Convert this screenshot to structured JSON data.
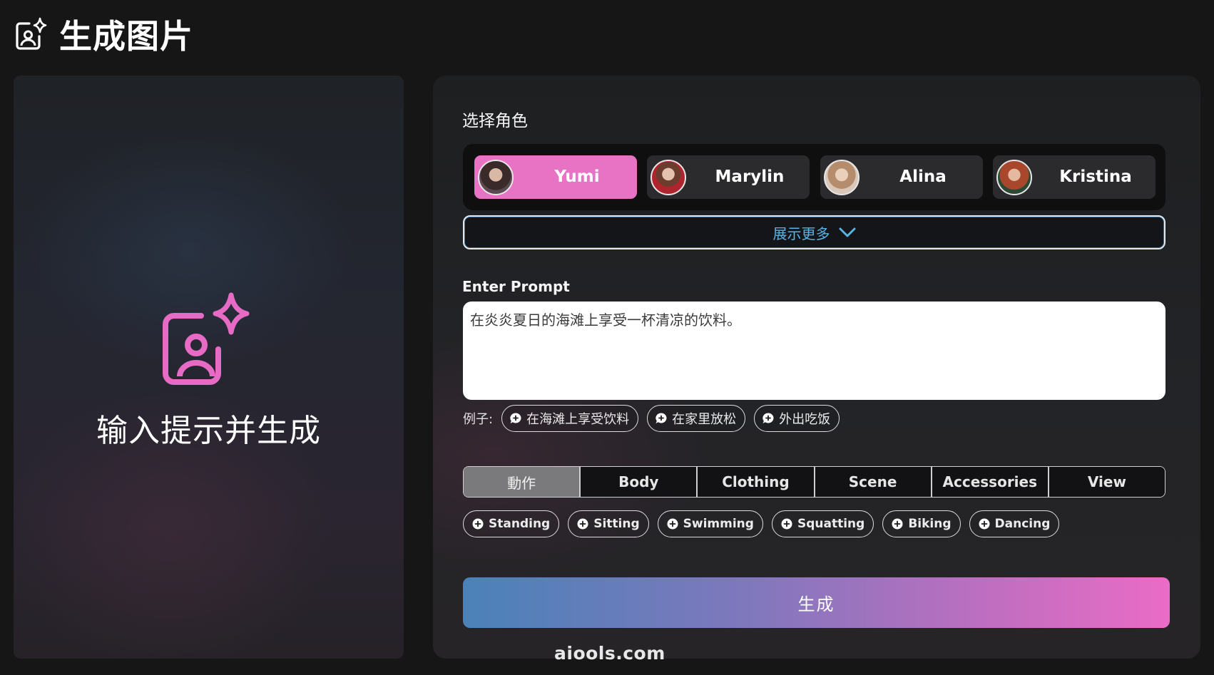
{
  "header": {
    "title": "生成图片",
    "icon": "image-sparkle-icon"
  },
  "left_panel": {
    "empty_text": "输入提示并生成",
    "icon": "image-sparkle-icon",
    "accent": "#e76ac5"
  },
  "role_section": {
    "label": "选择角色",
    "roles": [
      {
        "name": "Yumi",
        "active": true
      },
      {
        "name": "Marylin",
        "active": false
      },
      {
        "name": "Alina",
        "active": false
      },
      {
        "name": "Kristina",
        "active": false
      }
    ],
    "show_more": "展示更多"
  },
  "prompt_section": {
    "label": "Enter Prompt",
    "value": "在炎炎夏日的海滩上享受一杯清凉的饮料。",
    "examples_label": "例子:",
    "examples": [
      "在海滩上享受饮料",
      "在家里放松",
      "外出吃饭"
    ]
  },
  "category_tabs": [
    {
      "label": "動作",
      "active": true
    },
    {
      "label": "Body",
      "active": false
    },
    {
      "label": "Clothing",
      "active": false
    },
    {
      "label": "Scene",
      "active": false
    },
    {
      "label": "Accessories",
      "active": false
    },
    {
      "label": "View",
      "active": false
    }
  ],
  "actions": [
    "Standing",
    "Sitting",
    "Swimming",
    "Squatting",
    "Biking",
    "Dancing"
  ],
  "generate_label": "生成",
  "watermark": "aiools.com",
  "colors": {
    "accent_pink": "#e872c4",
    "gradient_start": "#4a82b8",
    "gradient_end": "#ea6cc6",
    "link_blue": "#5ab2e6"
  }
}
